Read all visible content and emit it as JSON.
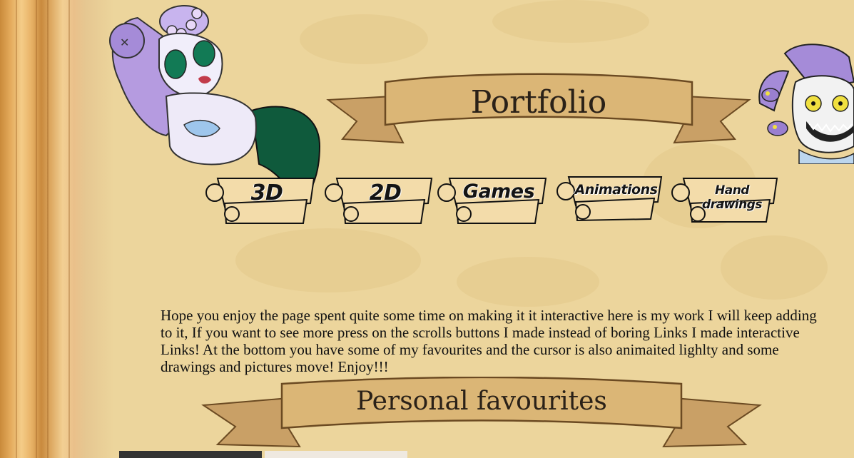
{
  "header": {
    "title": "Portfolio"
  },
  "nav": {
    "buttons": [
      {
        "label": "3D"
      },
      {
        "label": "2D"
      },
      {
        "label": "Games"
      },
      {
        "label": "Animations"
      },
      {
        "label": "Hand drawings"
      }
    ]
  },
  "intro": {
    "text": "Hope you enjoy the page spent quite some time on making it it interactive here is my work I will keep adding to it, If you want to see more press on the scrolls buttons I made instead of boring Links I made interactive Links! At the bottom you have some of my favourites and the cursor is also animaited lighlty and some drawings and pictures move! Enjoy!!!"
  },
  "favourites": {
    "title": "Personal favourites"
  },
  "colors": {
    "parchment": "#ecd59c",
    "ribbon": "#d8b070",
    "ribbon_dark": "#b98c4a",
    "text": "#2a2118"
  },
  "icons": [
    "octopus-mermaid-illustration",
    "medusa-illustration",
    "scroll-button-icon"
  ]
}
